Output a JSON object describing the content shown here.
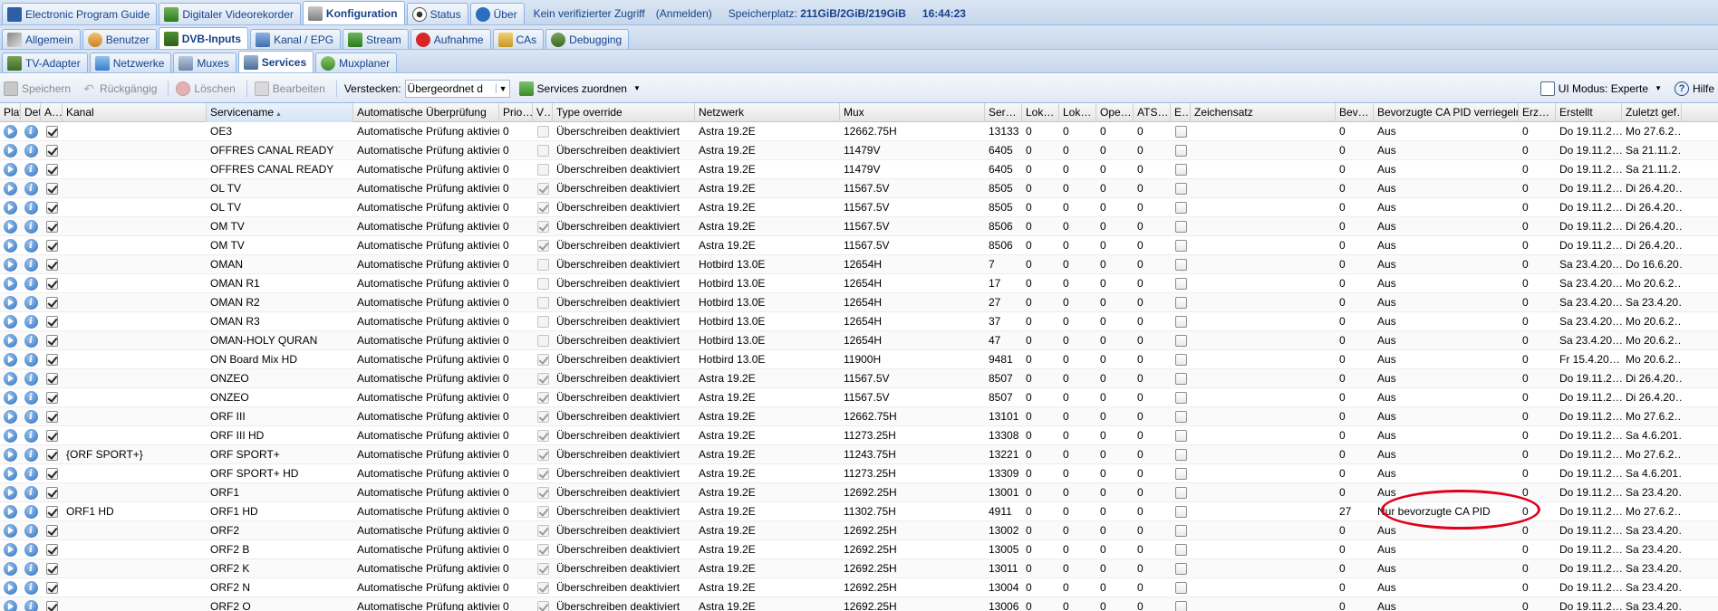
{
  "top_tabs": [
    {
      "label": "Electronic Program Guide",
      "icon": "epg-icon",
      "active": false
    },
    {
      "label": "Digitaler Videorekorder",
      "icon": "dvr-icon",
      "active": false
    },
    {
      "label": "Konfiguration",
      "icon": "wrench-icon",
      "active": true
    },
    {
      "label": "Status",
      "icon": "eye-icon",
      "active": false
    },
    {
      "label": "Über",
      "icon": "info-icon",
      "active": false
    }
  ],
  "status_bar": {
    "access": "Kein verifizierter Zugriff",
    "login": "(Anmelden)",
    "storage_label": "Speicherplatz:",
    "storage_value": "211GiB/2GiB/219GiB",
    "time": "16:44:23"
  },
  "second_tabs": [
    {
      "label": "Allgemein",
      "icon": "tools-icon",
      "active": false
    },
    {
      "label": "Benutzer",
      "icon": "users-icon",
      "active": false
    },
    {
      "label": "DVB-Inputs",
      "icon": "dvb-icon",
      "active": true
    },
    {
      "label": "Kanal / EPG",
      "icon": "channel-icon",
      "active": false
    },
    {
      "label": "Stream",
      "icon": "stream-icon",
      "active": false
    },
    {
      "label": "Aufnahme",
      "icon": "rec-icon",
      "active": false
    },
    {
      "label": "CAs",
      "icon": "key-icon",
      "active": false
    },
    {
      "label": "Debugging",
      "icon": "debug-icon",
      "active": false
    }
  ],
  "third_tabs": [
    {
      "label": "TV-Adapter",
      "icon": "tv-adapter-icon",
      "active": false
    },
    {
      "label": "Netzwerke",
      "icon": "network-icon",
      "active": false
    },
    {
      "label": "Muxes",
      "icon": "mux-icon",
      "active": false
    },
    {
      "label": "Services",
      "icon": "services-icon",
      "active": true
    },
    {
      "label": "Muxplaner",
      "icon": "muxplaner-icon",
      "active": false
    }
  ],
  "toolbar": {
    "save": "Speichern",
    "undo": "Rückgängig",
    "delete": "Löschen",
    "edit": "Bearbeiten",
    "hide_label": "Verstecken:",
    "hide_value": "Übergeordnet d",
    "map_services": "Services zuordnen",
    "ui_mode": "UI Modus: Experte",
    "help": "Hilfe"
  },
  "columns": [
    {
      "key": "play",
      "label": "Play",
      "w": 23
    },
    {
      "key": "details",
      "label": "Deta…",
      "w": 22
    },
    {
      "key": "a",
      "label": "A…",
      "w": 24
    },
    {
      "key": "kanal",
      "label": "Kanal",
      "w": 159
    },
    {
      "key": "servicename",
      "label": "Servicename",
      "w": 162
    },
    {
      "key": "auto",
      "label": "Automatische Überprüfung",
      "w": 161
    },
    {
      "key": "prio",
      "label": "Prio…",
      "w": 37
    },
    {
      "key": "v",
      "label": "V…",
      "w": 22
    },
    {
      "key": "type",
      "label": "Type override",
      "w": 157
    },
    {
      "key": "netzwerk",
      "label": "Netzwerk",
      "w": 160
    },
    {
      "key": "mux",
      "label": "Mux",
      "w": 160
    },
    {
      "key": "ser",
      "label": "Ser…",
      "w": 41
    },
    {
      "key": "lok1",
      "label": "Lok…",
      "w": 41
    },
    {
      "key": "lok2",
      "label": "Lok…",
      "w": 41
    },
    {
      "key": "ope",
      "label": "Ope…",
      "w": 41
    },
    {
      "key": "ats",
      "label": "ATS…",
      "w": 41
    },
    {
      "key": "e",
      "label": "E…",
      "w": 22
    },
    {
      "key": "zeichensatz",
      "label": "Zeichensatz",
      "w": 160
    },
    {
      "key": "bev",
      "label": "Bev…",
      "w": 42
    },
    {
      "key": "bevca",
      "label": "Bevorzugte CA PID verriegeln",
      "w": 160
    },
    {
      "key": "erz",
      "label": "Erz…",
      "w": 41
    },
    {
      "key": "erstellt",
      "label": "Erstellt",
      "w": 73
    },
    {
      "key": "zuletzt",
      "label": "Zuletzt gef…",
      "w": 66
    }
  ],
  "rows": [
    {
      "a": true,
      "kanal": "",
      "name": "OE3",
      "auto": "Automatische Prüfung aktiviert",
      "prio": "0",
      "v": false,
      "type": "Überschreiben deaktiviert",
      "net": "Astra 19.2E",
      "mux": "12662.75H",
      "ser": "13133",
      "lok1": "0",
      "lok2": "0",
      "ope": "0",
      "ats": "0",
      "e": false,
      "zs": "",
      "bev": "0",
      "bevca": "Aus",
      "erz": "0",
      "erst": "Do 19.11.2…",
      "zul": "Mo 27.6.2…"
    },
    {
      "a": true,
      "kanal": "",
      "name": "OFFRES CANAL READY",
      "auto": "Automatische Prüfung aktiviert",
      "prio": "0",
      "v": false,
      "type": "Überschreiben deaktiviert",
      "net": "Astra 19.2E",
      "mux": "11479V",
      "ser": "6405",
      "lok1": "0",
      "lok2": "0",
      "ope": "0",
      "ats": "0",
      "e": false,
      "zs": "",
      "bev": "0",
      "bevca": "Aus",
      "erz": "0",
      "erst": "Do 19.11.2…",
      "zul": "Sa 21.11.2…"
    },
    {
      "a": true,
      "kanal": "",
      "name": "OFFRES CANAL READY",
      "auto": "Automatische Prüfung aktiviert",
      "prio": "0",
      "v": false,
      "type": "Überschreiben deaktiviert",
      "net": "Astra 19.2E",
      "mux": "11479V",
      "ser": "6405",
      "lok1": "0",
      "lok2": "0",
      "ope": "0",
      "ats": "0",
      "e": false,
      "zs": "",
      "bev": "0",
      "bevca": "Aus",
      "erz": "0",
      "erst": "Do 19.11.2…",
      "zul": "Sa 21.11.2…"
    },
    {
      "a": true,
      "kanal": "",
      "name": "OL TV",
      "auto": "Automatische Prüfung aktiviert",
      "prio": "0",
      "v": true,
      "type": "Überschreiben deaktiviert",
      "net": "Astra 19.2E",
      "mux": "11567.5V",
      "ser": "8505",
      "lok1": "0",
      "lok2": "0",
      "ope": "0",
      "ats": "0",
      "e": false,
      "zs": "",
      "bev": "0",
      "bevca": "Aus",
      "erz": "0",
      "erst": "Do 19.11.2…",
      "zul": "Di 26.4.20…"
    },
    {
      "a": true,
      "kanal": "",
      "name": "OL TV",
      "auto": "Automatische Prüfung aktiviert",
      "prio": "0",
      "v": true,
      "type": "Überschreiben deaktiviert",
      "net": "Astra 19.2E",
      "mux": "11567.5V",
      "ser": "8505",
      "lok1": "0",
      "lok2": "0",
      "ope": "0",
      "ats": "0",
      "e": false,
      "zs": "",
      "bev": "0",
      "bevca": "Aus",
      "erz": "0",
      "erst": "Do 19.11.2…",
      "zul": "Di 26.4.20…"
    },
    {
      "a": true,
      "kanal": "",
      "name": "OM TV",
      "auto": "Automatische Prüfung aktiviert",
      "prio": "0",
      "v": true,
      "type": "Überschreiben deaktiviert",
      "net": "Astra 19.2E",
      "mux": "11567.5V",
      "ser": "8506",
      "lok1": "0",
      "lok2": "0",
      "ope": "0",
      "ats": "0",
      "e": false,
      "zs": "",
      "bev": "0",
      "bevca": "Aus",
      "erz": "0",
      "erst": "Do 19.11.2…",
      "zul": "Di 26.4.20…"
    },
    {
      "a": true,
      "kanal": "",
      "name": "OM TV",
      "auto": "Automatische Prüfung aktiviert",
      "prio": "0",
      "v": true,
      "type": "Überschreiben deaktiviert",
      "net": "Astra 19.2E",
      "mux": "11567.5V",
      "ser": "8506",
      "lok1": "0",
      "lok2": "0",
      "ope": "0",
      "ats": "0",
      "e": false,
      "zs": "",
      "bev": "0",
      "bevca": "Aus",
      "erz": "0",
      "erst": "Do 19.11.2…",
      "zul": "Di 26.4.20…"
    },
    {
      "a": true,
      "kanal": "",
      "name": "OMAN",
      "auto": "Automatische Prüfung aktiviert",
      "prio": "0",
      "v": false,
      "type": "Überschreiben deaktiviert",
      "net": "Hotbird 13.0E",
      "mux": "12654H",
      "ser": "7",
      "lok1": "0",
      "lok2": "0",
      "ope": "0",
      "ats": "0",
      "e": false,
      "zs": "",
      "bev": "0",
      "bevca": "Aus",
      "erz": "0",
      "erst": "Sa 23.4.20…",
      "zul": "Do 16.6.20…"
    },
    {
      "a": true,
      "kanal": "",
      "name": "OMAN R1",
      "auto": "Automatische Prüfung aktiviert",
      "prio": "0",
      "v": false,
      "type": "Überschreiben deaktiviert",
      "net": "Hotbird 13.0E",
      "mux": "12654H",
      "ser": "17",
      "lok1": "0",
      "lok2": "0",
      "ope": "0",
      "ats": "0",
      "e": false,
      "zs": "",
      "bev": "0",
      "bevca": "Aus",
      "erz": "0",
      "erst": "Sa 23.4.20…",
      "zul": "Mo 20.6.2…"
    },
    {
      "a": true,
      "kanal": "",
      "name": "OMAN R2",
      "auto": "Automatische Prüfung aktiviert",
      "prio": "0",
      "v": false,
      "type": "Überschreiben deaktiviert",
      "net": "Hotbird 13.0E",
      "mux": "12654H",
      "ser": "27",
      "lok1": "0",
      "lok2": "0",
      "ope": "0",
      "ats": "0",
      "e": false,
      "zs": "",
      "bev": "0",
      "bevca": "Aus",
      "erz": "0",
      "erst": "Sa 23.4.20…",
      "zul": "Sa 23.4.20…"
    },
    {
      "a": true,
      "kanal": "",
      "name": "OMAN R3",
      "auto": "Automatische Prüfung aktiviert",
      "prio": "0",
      "v": false,
      "type": "Überschreiben deaktiviert",
      "net": "Hotbird 13.0E",
      "mux": "12654H",
      "ser": "37",
      "lok1": "0",
      "lok2": "0",
      "ope": "0",
      "ats": "0",
      "e": false,
      "zs": "",
      "bev": "0",
      "bevca": "Aus",
      "erz": "0",
      "erst": "Sa 23.4.20…",
      "zul": "Mo 20.6.2…"
    },
    {
      "a": true,
      "kanal": "",
      "name": "OMAN-HOLY QURAN",
      "auto": "Automatische Prüfung aktiviert",
      "prio": "0",
      "v": false,
      "type": "Überschreiben deaktiviert",
      "net": "Hotbird 13.0E",
      "mux": "12654H",
      "ser": "47",
      "lok1": "0",
      "lok2": "0",
      "ope": "0",
      "ats": "0",
      "e": false,
      "zs": "",
      "bev": "0",
      "bevca": "Aus",
      "erz": "0",
      "erst": "Sa 23.4.20…",
      "zul": "Mo 20.6.2…"
    },
    {
      "a": true,
      "kanal": "",
      "name": "ON Board Mix HD",
      "auto": "Automatische Prüfung aktiviert",
      "prio": "0",
      "v": true,
      "type": "Überschreiben deaktiviert",
      "net": "Hotbird 13.0E",
      "mux": "11900H",
      "ser": "9481",
      "lok1": "0",
      "lok2": "0",
      "ope": "0",
      "ats": "0",
      "e": false,
      "zs": "",
      "bev": "0",
      "bevca": "Aus",
      "erz": "0",
      "erst": "Fr 15.4.20…",
      "zul": "Mo 20.6.2…"
    },
    {
      "a": true,
      "kanal": "",
      "name": "ONZEO",
      "auto": "Automatische Prüfung aktiviert",
      "prio": "0",
      "v": true,
      "type": "Überschreiben deaktiviert",
      "net": "Astra 19.2E",
      "mux": "11567.5V",
      "ser": "8507",
      "lok1": "0",
      "lok2": "0",
      "ope": "0",
      "ats": "0",
      "e": false,
      "zs": "",
      "bev": "0",
      "bevca": "Aus",
      "erz": "0",
      "erst": "Do 19.11.2…",
      "zul": "Di 26.4.20…"
    },
    {
      "a": true,
      "kanal": "",
      "name": "ONZEO",
      "auto": "Automatische Prüfung aktiviert",
      "prio": "0",
      "v": true,
      "type": "Überschreiben deaktiviert",
      "net": "Astra 19.2E",
      "mux": "11567.5V",
      "ser": "8507",
      "lok1": "0",
      "lok2": "0",
      "ope": "0",
      "ats": "0",
      "e": false,
      "zs": "",
      "bev": "0",
      "bevca": "Aus",
      "erz": "0",
      "erst": "Do 19.11.2…",
      "zul": "Di 26.4.20…"
    },
    {
      "a": true,
      "kanal": "",
      "name": "ORF III",
      "auto": "Automatische Prüfung aktiviert",
      "prio": "0",
      "v": true,
      "type": "Überschreiben deaktiviert",
      "net": "Astra 19.2E",
      "mux": "12662.75H",
      "ser": "13101",
      "lok1": "0",
      "lok2": "0",
      "ope": "0",
      "ats": "0",
      "e": false,
      "zs": "",
      "bev": "0",
      "bevca": "Aus",
      "erz": "0",
      "erst": "Do 19.11.2…",
      "zul": "Mo 27.6.2…"
    },
    {
      "a": true,
      "kanal": "",
      "name": "ORF III HD",
      "auto": "Automatische Prüfung aktiviert",
      "prio": "0",
      "v": true,
      "type": "Überschreiben deaktiviert",
      "net": "Astra 19.2E",
      "mux": "11273.25H",
      "ser": "13308",
      "lok1": "0",
      "lok2": "0",
      "ope": "0",
      "ats": "0",
      "e": false,
      "zs": "",
      "bev": "0",
      "bevca": "Aus",
      "erz": "0",
      "erst": "Do 19.11.2…",
      "zul": "Sa 4.6.201…"
    },
    {
      "a": true,
      "kanal": "{ORF SPORT+}",
      "name": "ORF SPORT+",
      "auto": "Automatische Prüfung aktiviert",
      "prio": "0",
      "v": true,
      "type": "Überschreiben deaktiviert",
      "net": "Astra 19.2E",
      "mux": "11243.75H",
      "ser": "13221",
      "lok1": "0",
      "lok2": "0",
      "ope": "0",
      "ats": "0",
      "e": false,
      "zs": "",
      "bev": "0",
      "bevca": "Aus",
      "erz": "0",
      "erst": "Do 19.11.2…",
      "zul": "Mo 27.6.2…"
    },
    {
      "a": true,
      "kanal": "",
      "name": "ORF SPORT+ HD",
      "auto": "Automatische Prüfung aktiviert",
      "prio": "0",
      "v": true,
      "type": "Überschreiben deaktiviert",
      "net": "Astra 19.2E",
      "mux": "11273.25H",
      "ser": "13309",
      "lok1": "0",
      "lok2": "0",
      "ope": "0",
      "ats": "0",
      "e": false,
      "zs": "",
      "bev": "0",
      "bevca": "Aus",
      "erz": "0",
      "erst": "Do 19.11.2…",
      "zul": "Sa 4.6.201…"
    },
    {
      "a": true,
      "kanal": "",
      "name": "ORF1",
      "auto": "Automatische Prüfung aktiviert",
      "prio": "0",
      "v": true,
      "type": "Überschreiben deaktiviert",
      "net": "Astra 19.2E",
      "mux": "12692.25H",
      "ser": "13001",
      "lok1": "0",
      "lok2": "0",
      "ope": "0",
      "ats": "0",
      "e": false,
      "zs": "",
      "bev": "0",
      "bevca": "Aus",
      "erz": "0",
      "erst": "Do 19.11.2…",
      "zul": "Sa 23.4.20…"
    },
    {
      "a": true,
      "kanal": "ORF1 HD",
      "name": "ORF1 HD",
      "auto": "Automatische Prüfung aktiviert",
      "prio": "0",
      "v": true,
      "type": "Überschreiben deaktiviert",
      "net": "Astra 19.2E",
      "mux": "11302.75H",
      "ser": "4911",
      "lok1": "0",
      "lok2": "0",
      "ope": "0",
      "ats": "0",
      "e": false,
      "zs": "",
      "bev": "27",
      "bevca": "Nur bevorzugte CA PID",
      "erz": "0",
      "erst": "Do 19.11.2…",
      "zul": "Mo 27.6.2…"
    },
    {
      "a": true,
      "kanal": "",
      "name": "ORF2",
      "auto": "Automatische Prüfung aktiviert",
      "prio": "0",
      "v": true,
      "type": "Überschreiben deaktiviert",
      "net": "Astra 19.2E",
      "mux": "12692.25H",
      "ser": "13002",
      "lok1": "0",
      "lok2": "0",
      "ope": "0",
      "ats": "0",
      "e": false,
      "zs": "",
      "bev": "0",
      "bevca": "Aus",
      "erz": "0",
      "erst": "Do 19.11.2…",
      "zul": "Sa 23.4.20…"
    },
    {
      "a": true,
      "kanal": "",
      "name": "ORF2 B",
      "auto": "Automatische Prüfung aktiviert",
      "prio": "0",
      "v": true,
      "type": "Überschreiben deaktiviert",
      "net": "Astra 19.2E",
      "mux": "12692.25H",
      "ser": "13005",
      "lok1": "0",
      "lok2": "0",
      "ope": "0",
      "ats": "0",
      "e": false,
      "zs": "",
      "bev": "0",
      "bevca": "Aus",
      "erz": "0",
      "erst": "Do 19.11.2…",
      "zul": "Sa 23.4.20…"
    },
    {
      "a": true,
      "kanal": "",
      "name": "ORF2 K",
      "auto": "Automatische Prüfung aktiviert",
      "prio": "0",
      "v": true,
      "type": "Überschreiben deaktiviert",
      "net": "Astra 19.2E",
      "mux": "12692.25H",
      "ser": "13011",
      "lok1": "0",
      "lok2": "0",
      "ope": "0",
      "ats": "0",
      "e": false,
      "zs": "",
      "bev": "0",
      "bevca": "Aus",
      "erz": "0",
      "erst": "Do 19.11.2…",
      "zul": "Sa 23.4.20…"
    },
    {
      "a": true,
      "kanal": "",
      "name": "ORF2 N",
      "auto": "Automatische Prüfung aktiviert",
      "prio": "0",
      "v": true,
      "type": "Überschreiben deaktiviert",
      "net": "Astra 19.2E",
      "mux": "12692.25H",
      "ser": "13004",
      "lok1": "0",
      "lok2": "0",
      "ope": "0",
      "ats": "0",
      "e": false,
      "zs": "",
      "bev": "0",
      "bevca": "Aus",
      "erz": "0",
      "erst": "Do 19.11.2…",
      "zul": "Sa 23.4.20…"
    },
    {
      "a": true,
      "kanal": "",
      "name": "ORF2 O",
      "auto": "Automatische Prüfung aktiviert",
      "prio": "0",
      "v": true,
      "type": "Überschreiben deaktiviert",
      "net": "Astra 19.2E",
      "mux": "12692.25H",
      "ser": "13006",
      "lok1": "0",
      "lok2": "0",
      "ope": "0",
      "ats": "0",
      "e": false,
      "zs": "",
      "bev": "0",
      "bevca": "Aus",
      "erz": "0",
      "erst": "Do 19.11.2…",
      "zul": "Sa 23.4.20…"
    }
  ],
  "colors": {
    "annotation": "#e0001b",
    "tab_text": "#15428b"
  }
}
